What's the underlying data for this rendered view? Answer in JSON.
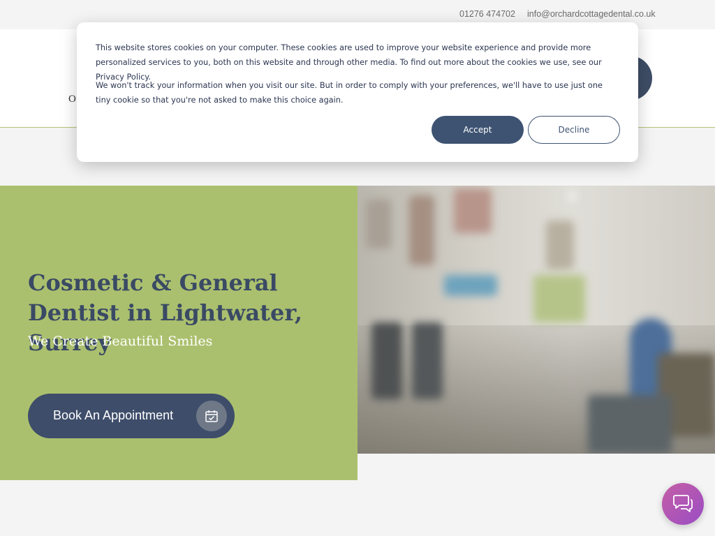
{
  "topbar": {
    "phone": "01276 474702",
    "email": "info@orchardcottagedental.co.uk"
  },
  "header": {
    "logo_visible_fragment": "O"
  },
  "cookie_banner": {
    "paragraph_1": "This website stores cookies on your computer. These cookies are used to improve your website experience and provide more personalized services to you, both on this website and through other media. To find out more about the cookies we use, see our Privacy Policy.",
    "paragraph_2": "We won't track your information when you visit our site. But in order to comply with your preferences, we'll have to use just one tiny cookie so that you're not asked to make this choice again.",
    "accept_label": "Accept",
    "decline_label": "Decline"
  },
  "hero": {
    "title": "Cosmetic & General Dentist in Lightwater, Surrey",
    "subtitle": "We Create Beautiful Smiles",
    "cta_label": "Book An Appointment",
    "cta_icon": "calendar-check-icon"
  },
  "chat": {
    "icon": "chat-bubbles-icon"
  },
  "colors": {
    "brand_navy": "#3e4d6a",
    "brand_green": "#abc06e",
    "chat_gradient_start": "#c55fa6",
    "chat_gradient_end": "#9a4cc4"
  }
}
